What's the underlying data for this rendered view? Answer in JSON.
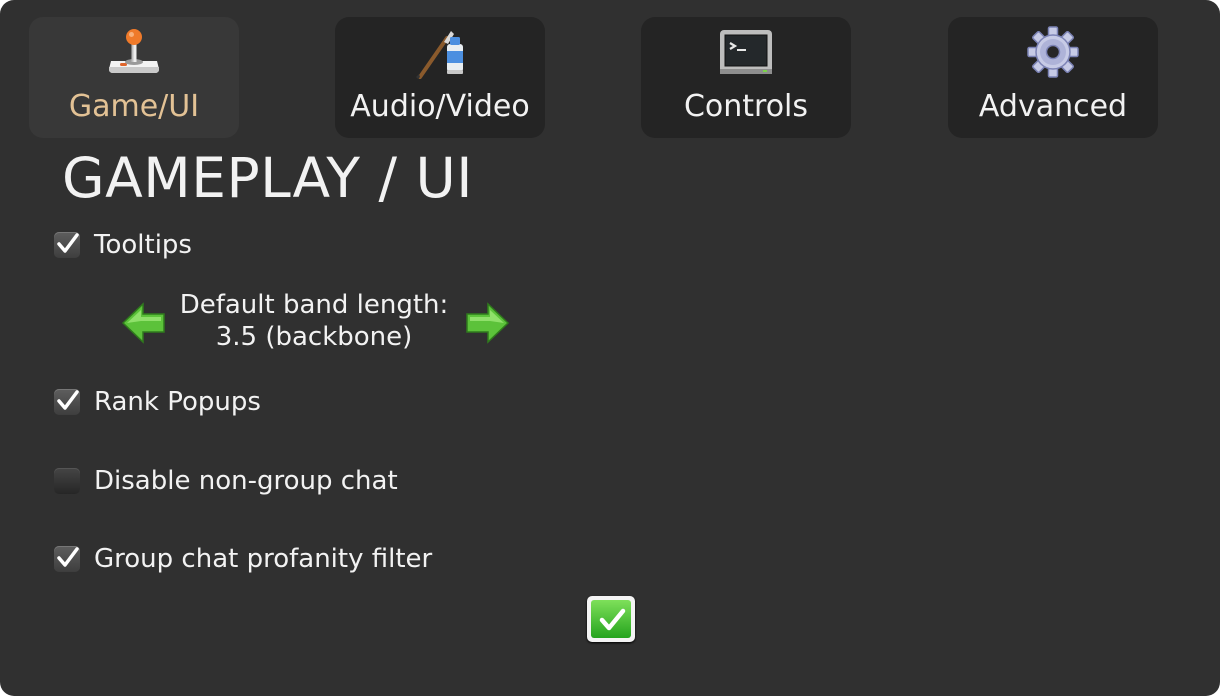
{
  "tabs": [
    {
      "label": "Game/UI",
      "icon": "joystick-icon",
      "active": true
    },
    {
      "label": "Audio/Video",
      "icon": "paint-tube-brush-icon",
      "active": false
    },
    {
      "label": "Controls",
      "icon": "terminal-icon",
      "active": false
    },
    {
      "label": "Advanced",
      "icon": "gear-icon",
      "active": false
    }
  ],
  "section": {
    "title": "GAMEPLAY / UI"
  },
  "options": {
    "tooltips": {
      "label": "Tooltips",
      "checked": true
    },
    "rank_popups": {
      "label": "Rank Popups",
      "checked": true
    },
    "disable_non_group_chat": {
      "label": "Disable non-group chat",
      "checked": false
    },
    "profanity_filter": {
      "label": "Group chat profanity filter",
      "checked": true
    }
  },
  "band_length": {
    "line1": "Default band length:",
    "line2": "3.5 (backbone)",
    "prev_icon": "arrow-left-icon",
    "next_icon": "arrow-right-icon"
  },
  "confirm": {
    "icon": "checkmark-icon"
  },
  "colors": {
    "panel_bg": "#303030",
    "tab_bg": "#242424",
    "active_tab_bg": "#383838",
    "active_tab_text": "#e3c295",
    "text": "#f2f2f2",
    "arrow_green": "#5cc23a",
    "ok_green": "#34b828"
  }
}
